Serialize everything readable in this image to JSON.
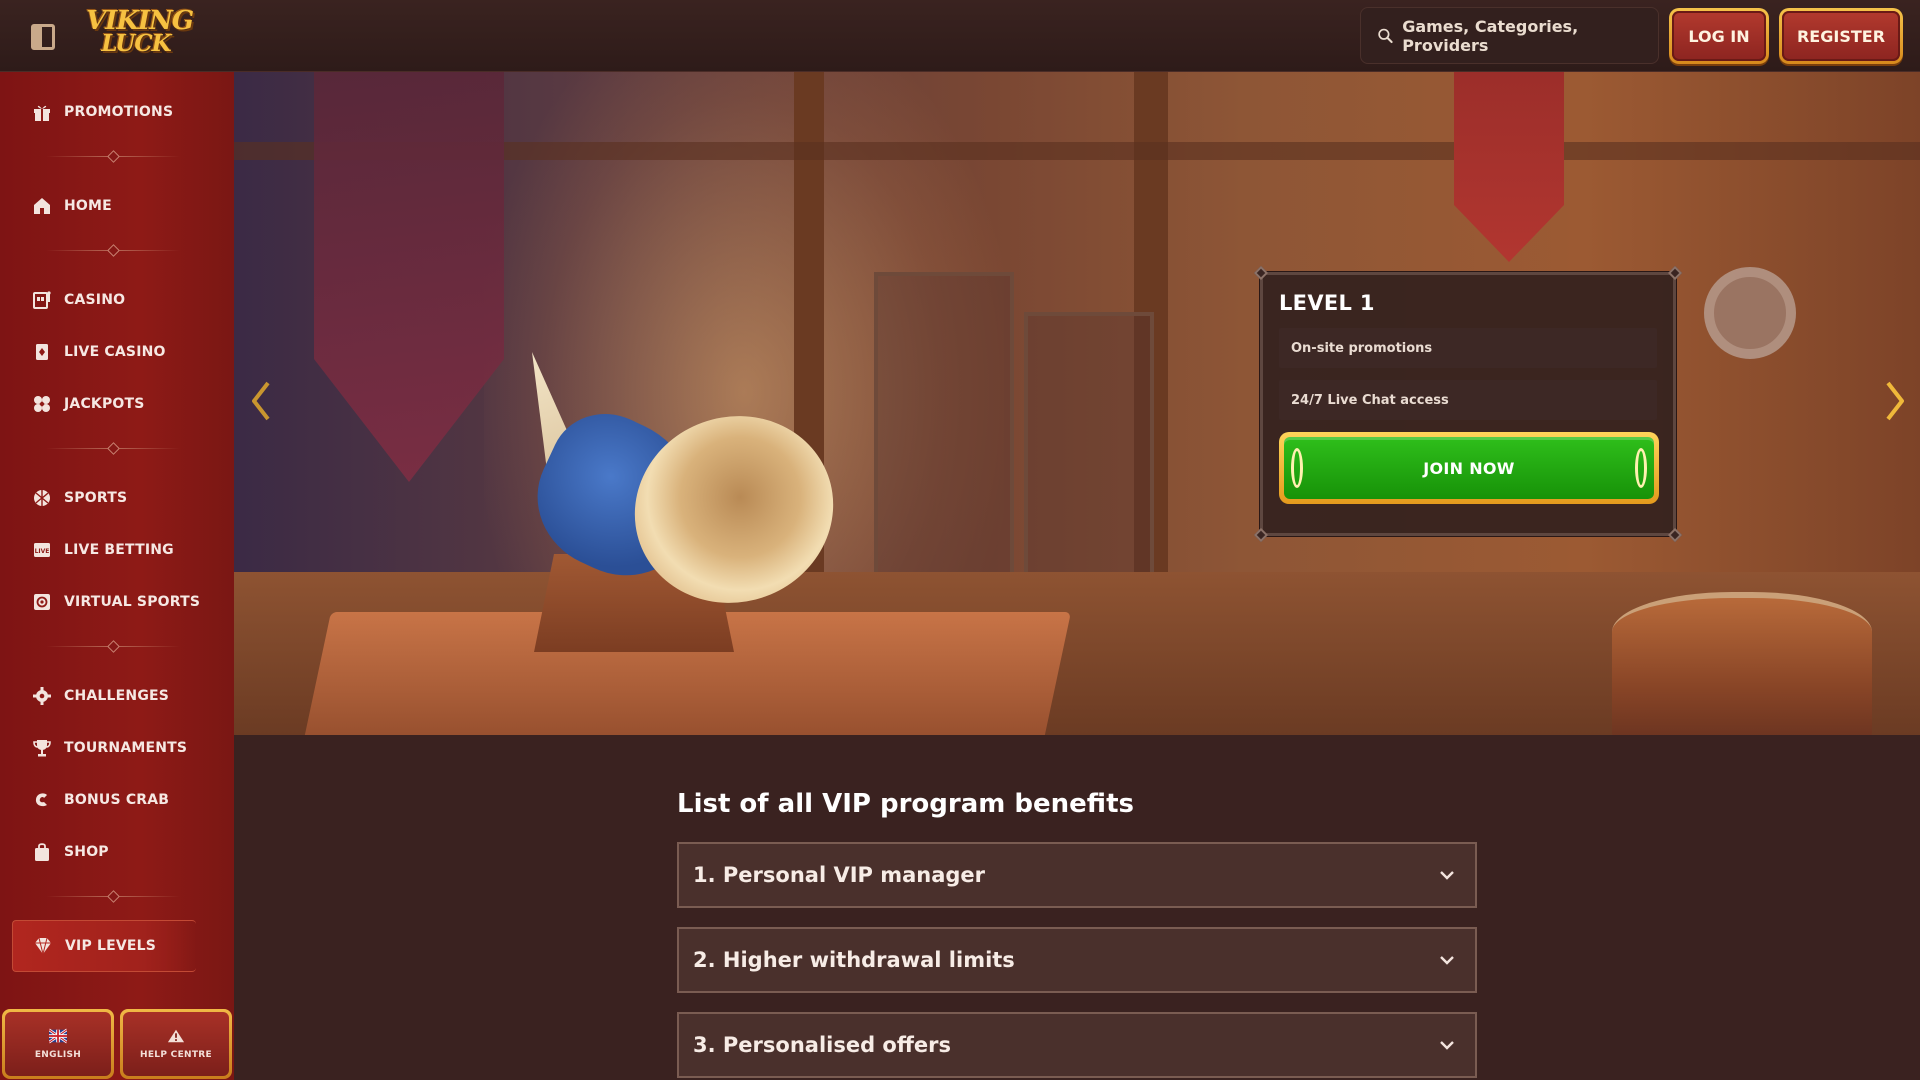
{
  "header": {
    "logo_line1": "VIKING",
    "logo_line2": "LUCK",
    "search_placeholder": "Games, Categories, Providers",
    "login_label": "LOG IN",
    "register_label": "REGISTER"
  },
  "sidebar": {
    "items": [
      {
        "label": "PROMOTIONS",
        "icon": "gift-icon"
      },
      {
        "label": "HOME",
        "icon": "home-icon"
      },
      {
        "label": "CASINO",
        "icon": "slot-machine-icon"
      },
      {
        "label": "LIVE CASINO",
        "icon": "cards-icon"
      },
      {
        "label": "JACKPOTS",
        "icon": "clover-icon"
      },
      {
        "label": "SPORTS",
        "icon": "ball-icon"
      },
      {
        "label": "LIVE BETTING",
        "icon": "live-icon"
      },
      {
        "label": "VIRTUAL SPORTS",
        "icon": "virtual-icon"
      },
      {
        "label": "CHALLENGES",
        "icon": "gear-icon"
      },
      {
        "label": "TOURNAMENTS",
        "icon": "trophy-icon"
      },
      {
        "label": "BONUS CRAB",
        "icon": "crab-icon"
      },
      {
        "label": "SHOP",
        "icon": "bag-icon"
      },
      {
        "label": "VIP LEVELS",
        "icon": "diamond-icon",
        "active": true
      }
    ],
    "footer": {
      "language_label": "ENGLISH",
      "help_label": "HELP CENTRE"
    }
  },
  "hero": {
    "level_title": "LEVEL 1",
    "perks": [
      "On-site promotions",
      "24/7 Live Chat access"
    ],
    "cta_label": "JOIN NOW"
  },
  "benefits": {
    "title": "List of all VIP program benefits",
    "items": [
      "1. Personal VIP manager",
      "2. Higher withdrawal limits",
      "3. Personalised offers"
    ]
  },
  "colors": {
    "sidebar_red": "#8e1a16",
    "gold": "#f5c34a",
    "cta_green": "#2fbf1b",
    "page_bg": "#3a2220"
  }
}
